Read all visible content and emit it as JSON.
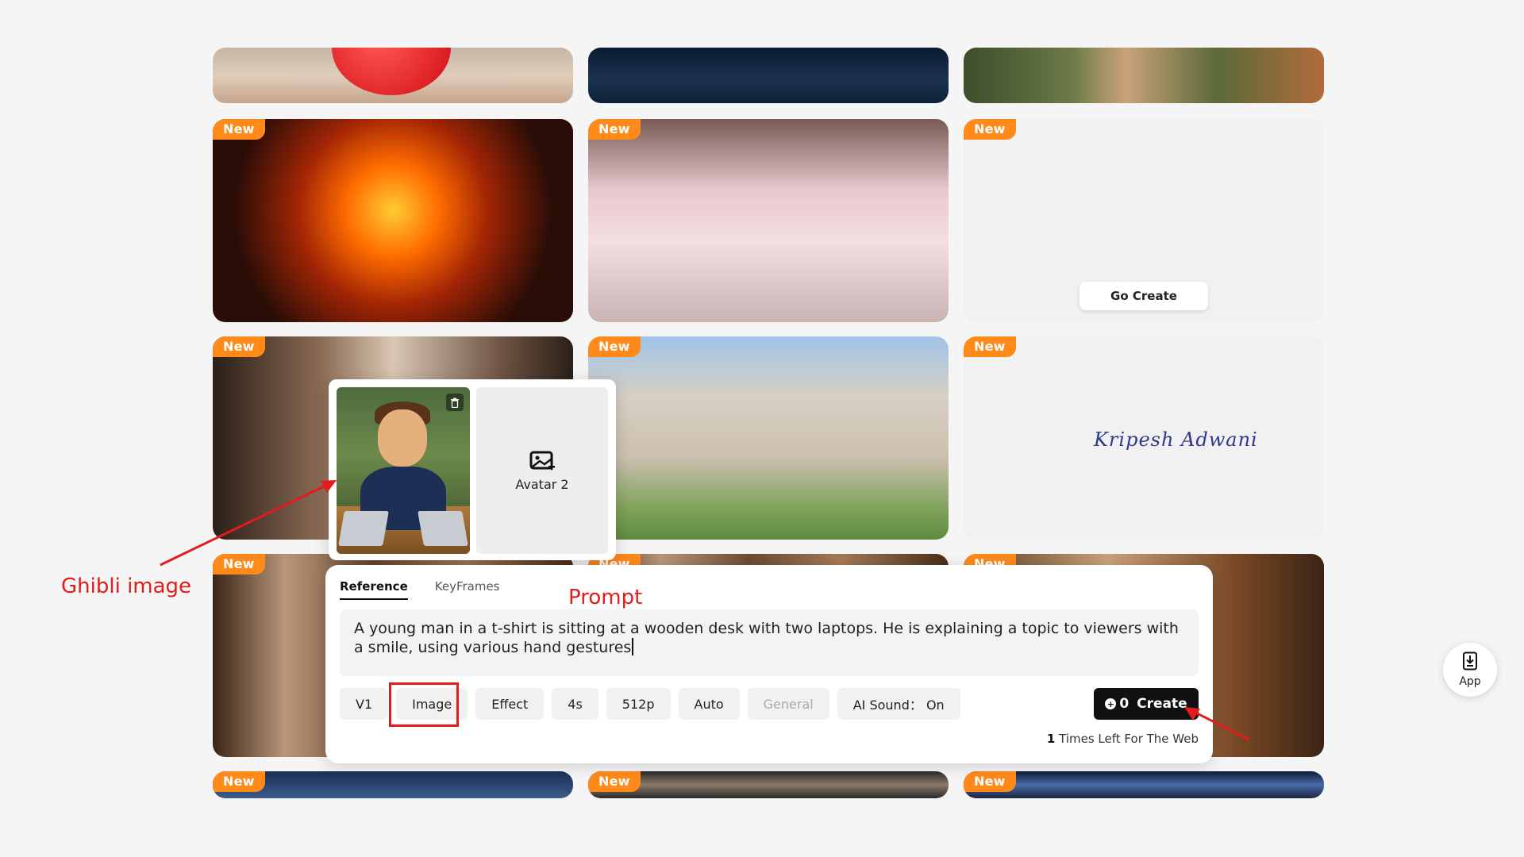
{
  "gallery": {
    "badge": "New",
    "go_create": "Go Create",
    "signature": "Kripesh Adwani"
  },
  "avatar_popup": {
    "avatar2_label": "Avatar 2"
  },
  "prompt_panel": {
    "tabs": [
      "Reference",
      "KeyFrames"
    ],
    "prompt_text": "A young man in a t-shirt is sitting at a wooden desk with two laptops. He is explaining a topic to viewers with a smile, using various hand gestures",
    "options": [
      "V1",
      "Image",
      "Effect",
      "4s",
      "512p",
      "Auto",
      "General",
      "AI Sound： On"
    ],
    "create_count": "0",
    "create_label": "Create",
    "times_left_count": "1",
    "times_left_text": "Times Left For The Web"
  },
  "annotations": {
    "ghibli_label": "Ghibli image",
    "prompt_label": "Prompt"
  },
  "app_button": {
    "label": "App"
  },
  "colors": {
    "badge": "#ff8a1a",
    "annotation": "#e31b1b",
    "create_button": "#111111"
  }
}
